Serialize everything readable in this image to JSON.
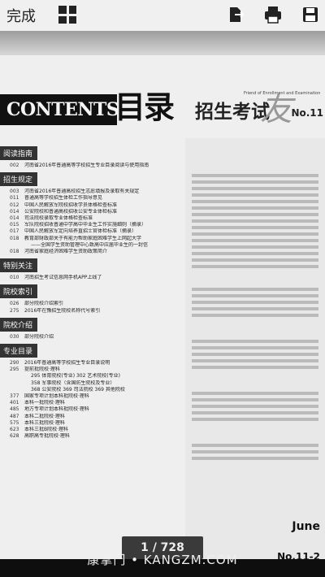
{
  "toolbar": {
    "done_label": "完成",
    "icons": [
      "grid-icon",
      "export-icon",
      "print-icon",
      "save-icon"
    ]
  },
  "header": {
    "contents_label": "CONTENTS",
    "mulu_label": "目录",
    "journal_en": "Friend of Enrollment and Examination",
    "journal_cn": "招生考试",
    "journal_mark": "友",
    "issue_label": "No.11"
  },
  "toc": {
    "sections": [
      {
        "title": "阅读指南",
        "items": [
          {
            "page": "002",
            "text": "河南省2016年普通高等学校招生专业目录阅读与使用指南"
          }
        ]
      },
      {
        "title": "招生规定",
        "items": [
          {
            "page": "003",
            "text": "河南省2016年普通高校招生志愿填报及录取有关规定"
          },
          {
            "page": "011",
            "text": "普通高等学校招生体检工作指导意见"
          },
          {
            "page": "012",
            "text": "中国人民解放军院校招收学员体格检查标准"
          },
          {
            "page": "014",
            "text": "公安院校和普通高校招收公安专业体检标准"
          },
          {
            "page": "014",
            "text": "司法院校录取专业体格检查标准"
          },
          {
            "page": "015",
            "text": "军队院校招收普通中学高中毕业生工作实施细则（摘录）"
          },
          {
            "page": "017",
            "text": "中国人民解放军定向培养直招士官体检标准（摘录）"
          },
          {
            "page": "018",
            "text": "教育部财政部关于有能力帮助家庭困难学生上网起大学"
          },
          {
            "page": "",
            "text": "——全国学生资助管理中心致高中应届毕业生的一封信",
            "sub": true
          },
          {
            "page": "018",
            "text": "河南省家庭经济困难学生资助政策简介"
          }
        ]
      },
      {
        "title": "特别关注",
        "items": [
          {
            "page": "010",
            "text": "河南招生考试信息网手机APP上线了"
          }
        ]
      },
      {
        "title": "院校索引",
        "items": [
          {
            "page": "026",
            "text": "部分院校介绍索引"
          },
          {
            "page": "275",
            "text": "2016年在豫招生院校名称代号索引"
          }
        ]
      },
      {
        "title": "院校介绍",
        "items": [
          {
            "page": "030",
            "text": "部分院校介绍"
          }
        ]
      },
      {
        "title": "专业目录",
        "items": [
          {
            "page": "290",
            "text": "2016年普通高等学校招生专业目录说明"
          },
          {
            "page": "295",
            "text": "提前批院校·理科"
          },
          {
            "page": "",
            "text": "295 体育院校(专业)  302 艺术院校(专业)",
            "sub": true
          },
          {
            "page": "",
            "text": "358 军事院校（含国防生院校及专业）",
            "sub": true
          },
          {
            "page": "",
            "text": "368 公安院校  369 司法院校  369 其他院校",
            "sub": true
          },
          {
            "page": "377",
            "text": "国家专项计划本科批院校·理科"
          },
          {
            "page": "401",
            "text": "本科一批院校·理科"
          },
          {
            "page": "485",
            "text": "地方专项计划本科批院校·理科"
          },
          {
            "page": "487",
            "text": "本科二批院校·理科"
          },
          {
            "page": "575",
            "text": "本科三批院校·理科"
          },
          {
            "page": "623",
            "text": "本科三批B院校·理科"
          },
          {
            "page": "628",
            "text": "高职高专批院校·理科"
          }
        ]
      }
    ]
  },
  "right_panel": {
    "june_label": "June",
    "issue_label": "No.11-2"
  },
  "pager": {
    "label": "1 / 728"
  },
  "watermark": {
    "text": "康掌门 • KANGZM.COM"
  }
}
